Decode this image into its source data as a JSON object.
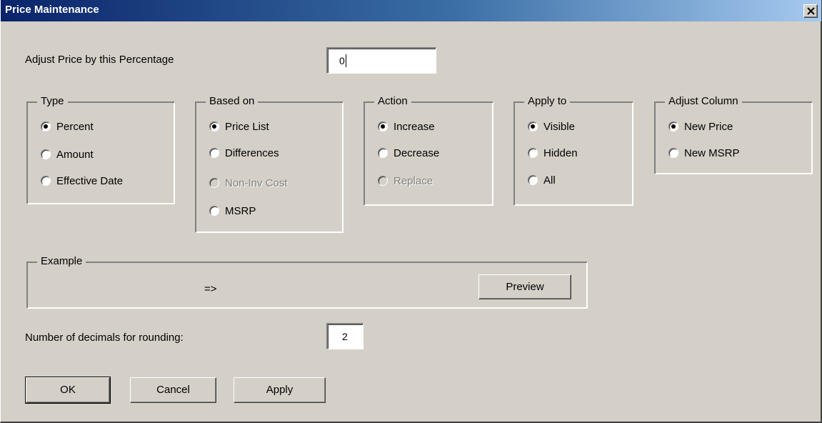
{
  "window": {
    "title": "Price Maintenance",
    "close_glyph": "×"
  },
  "colors": {
    "titlebar_start": "#0a246a",
    "titlebar_end": "#a6caf0",
    "face": "#d4d0c8"
  },
  "adjust_percentage": {
    "label": "Adjust Price by this Percentage",
    "value": "0"
  },
  "groups": {
    "type": {
      "legend": "Type",
      "options": [
        {
          "label": "Percent",
          "checked": true,
          "enabled": true
        },
        {
          "label": "Amount",
          "checked": false,
          "enabled": true
        },
        {
          "label": "Effective Date",
          "checked": false,
          "enabled": true
        }
      ]
    },
    "based_on": {
      "legend": "Based on",
      "options": [
        {
          "label": "Price List",
          "checked": true,
          "enabled": true
        },
        {
          "label": "Differences",
          "checked": false,
          "enabled": true
        },
        {
          "label": "Non-Inv Cost",
          "checked": false,
          "enabled": false
        },
        {
          "label": "MSRP",
          "checked": false,
          "enabled": true
        }
      ]
    },
    "action": {
      "legend": "Action",
      "options": [
        {
          "label": "Increase",
          "checked": true,
          "enabled": true
        },
        {
          "label": "Decrease",
          "checked": false,
          "enabled": true
        },
        {
          "label": "Replace",
          "checked": false,
          "enabled": false
        }
      ]
    },
    "apply_to": {
      "legend": "Apply to",
      "options": [
        {
          "label": "Visible",
          "checked": true,
          "enabled": true
        },
        {
          "label": "Hidden",
          "checked": false,
          "enabled": true
        },
        {
          "label": "All",
          "checked": false,
          "enabled": true
        }
      ]
    },
    "adjust_column": {
      "legend": "Adjust Column",
      "options": [
        {
          "label": "New Price",
          "checked": true,
          "enabled": true
        },
        {
          "label": "New MSRP",
          "checked": false,
          "enabled": true
        }
      ]
    }
  },
  "example": {
    "legend": "Example",
    "arrow_text": "=>",
    "preview_label": "Preview"
  },
  "rounding": {
    "label": "Number of decimals for rounding:",
    "value": "2"
  },
  "buttons": {
    "ok": "OK",
    "cancel": "Cancel",
    "apply": "Apply"
  }
}
